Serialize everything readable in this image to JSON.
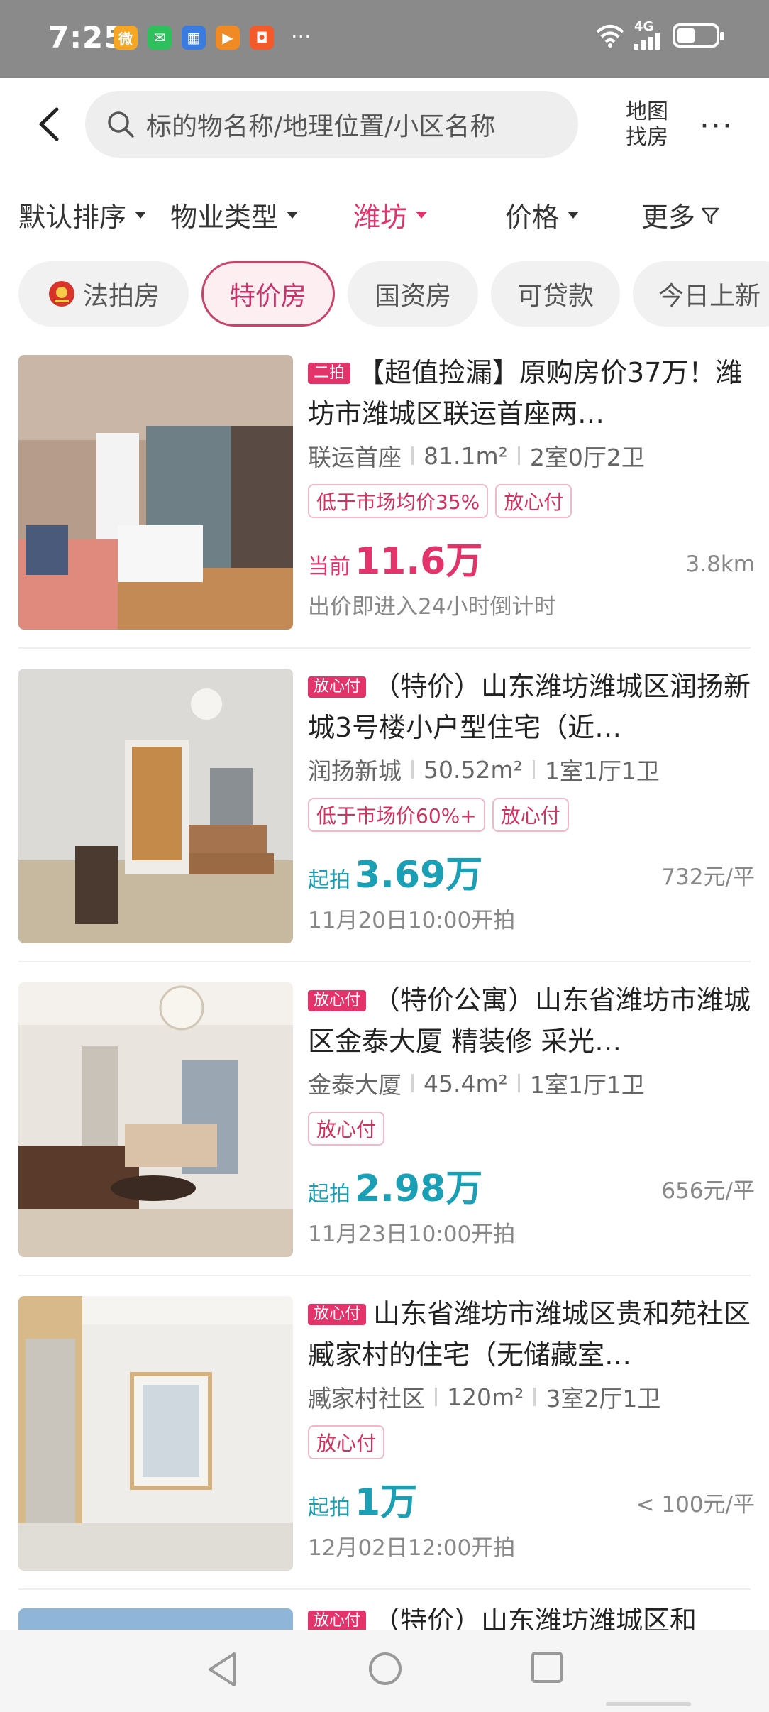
{
  "status": {
    "time": "7:25",
    "network": "4G",
    "apps": [
      {
        "icon": "weibo-icon",
        "glyph": "微",
        "color": "#f5a623"
      },
      {
        "icon": "wechat-icon",
        "glyph": "✉",
        "color": "#2fbf5c"
      },
      {
        "icon": "calendar-icon",
        "glyph": "▦",
        "color": "#3a7be0"
      },
      {
        "icon": "video-app-icon",
        "glyph": "▶",
        "color": "#f08a24"
      },
      {
        "icon": "shopping-app-icon",
        "glyph": "◘",
        "color": "#f25a2a"
      }
    ],
    "more": "···"
  },
  "search": {
    "placeholder": "标的物名称/地理位置/小区名称"
  },
  "header": {
    "map_line1": "地图",
    "map_line2": "找房",
    "more": "···"
  },
  "filters": [
    {
      "label": "默认排序",
      "active": false
    },
    {
      "label": "物业类型",
      "active": false
    },
    {
      "label": "潍坊",
      "active": true
    },
    {
      "label": "价格",
      "active": false
    },
    {
      "label": "更多",
      "active": false
    }
  ],
  "tags": [
    {
      "label": "法拍房",
      "active": false
    },
    {
      "label": "特价房",
      "active": true
    },
    {
      "label": "国资房",
      "active": false
    },
    {
      "label": "可贷款",
      "active": false
    },
    {
      "label": "今日上新",
      "active": false
    }
  ],
  "listings": [
    {
      "badge": "二拍",
      "title": "【超值捡漏】原购房价37万！潍坊市潍城区联运首座两…",
      "community": "联运首座",
      "area": "81.1m²",
      "layout": "2室0厅2卫",
      "chips": [
        "低于市场均价35%",
        "放心付"
      ],
      "price_label": "当前",
      "price": "11.6万",
      "price_color": "#e2336b",
      "right_info": "3.8km",
      "sub": "出价即进入24小时倒计时"
    },
    {
      "badge": "放心付",
      "title": "（特价）山东潍坊潍城区润扬新城3号楼小户型住宅（近…",
      "community": "润扬新城",
      "area": "50.52m²",
      "layout": "1室1厅1卫",
      "chips": [
        "低于市场价60%+",
        "放心付"
      ],
      "price_label": "起拍",
      "price": "3.69万",
      "price_color": "#1a9fb5",
      "right_info": "732元/平",
      "sub": "11月20日10:00开拍"
    },
    {
      "badge": "放心付",
      "title": "（特价公寓）山东省潍坊市潍城区金泰大厦 精装修 采光…",
      "community": "金泰大厦",
      "area": "45.4m²",
      "layout": "1室1厅1卫",
      "chips": [
        "放心付"
      ],
      "price_label": "起拍",
      "price": "2.98万",
      "price_color": "#1a9fb5",
      "right_info": "656元/平",
      "sub": "11月23日10:00开拍"
    },
    {
      "badge": "放心付",
      "title": "山东省潍坊市潍城区贵和苑社区臧家村的住宅（无储藏室…",
      "community": "臧家村社区",
      "area": "120m²",
      "layout": "3室2厅1卫",
      "chips": [
        "放心付"
      ],
      "price_label": "起拍",
      "price": "1万",
      "price_color": "#1a9fb5",
      "right_info": "< 100元/平",
      "sub": "12月02日12:00开拍"
    }
  ],
  "partial_listing": {
    "badge": "放心付",
    "title": "（特价）山东潍坊潍城区和"
  }
}
